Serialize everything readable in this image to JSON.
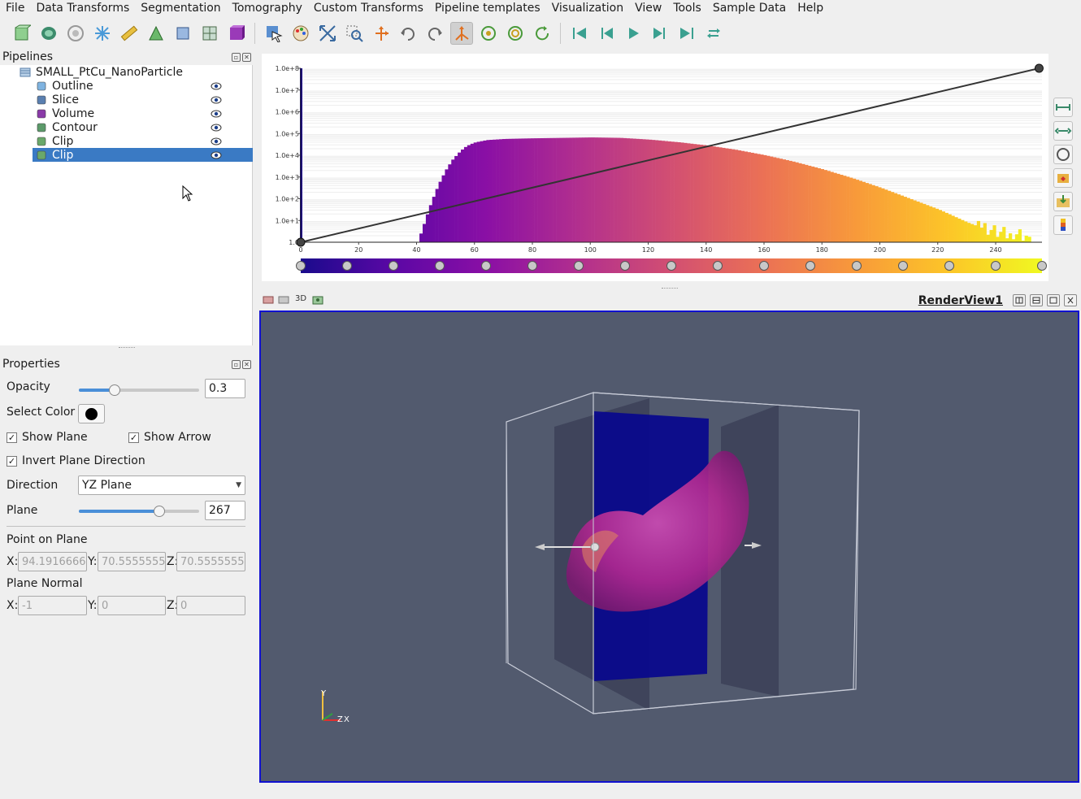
{
  "menu": [
    "File",
    "Data Transforms",
    "Segmentation",
    "Tomography",
    "Custom Transforms",
    "Pipeline templates",
    "Visualization",
    "View",
    "Tools",
    "Sample Data",
    "Help"
  ],
  "pipelines": {
    "title": "Pipelines",
    "root": "SMALL_PtCu_NanoParticle",
    "items": [
      {
        "label": "Outline",
        "icon": "outline-icon",
        "color": "#7fb3e0"
      },
      {
        "label": "Slice",
        "icon": "slice-icon",
        "color": "#5a7fb0"
      },
      {
        "label": "Volume",
        "icon": "volume-icon",
        "color": "#8a3aa8"
      },
      {
        "label": "Contour",
        "icon": "contour-icon",
        "color": "#5c9a6a"
      },
      {
        "label": "Clip",
        "icon": "clip-icon",
        "color": "#6aa86a"
      },
      {
        "label": "Clip",
        "icon": "clip-icon",
        "color": "#6aa86a"
      }
    ]
  },
  "properties": {
    "title": "Properties",
    "opacity_label": "Opacity",
    "opacity_value": "0.3",
    "opacity_fraction": 0.3,
    "select_color_label": "Select Color",
    "show_plane_label": "Show Plane",
    "show_arrow_label": "Show Arrow",
    "invert_label": "Invert Plane Direction",
    "direction_label": "Direction",
    "direction_value": "YZ Plane",
    "plane_label": "Plane",
    "plane_value": "267",
    "plane_fraction": 0.67,
    "point_label": "Point on Plane",
    "point": {
      "x": "94.1916666",
      "y": "70.5555555",
      "z": "70.5555555"
    },
    "normal_label": "Plane Normal",
    "normal": {
      "x": "-1",
      "y": "0",
      "z": "0"
    },
    "x_label": "X:",
    "y_label": "Y:",
    "z_label": "Z:"
  },
  "render_view": {
    "title": "RenderView1",
    "mode": "3D",
    "bg_color": "#525a6e",
    "axes": {
      "y": "Y",
      "z": "Z",
      "x": "X"
    }
  },
  "chart_data": {
    "type": "bar",
    "scale": "log",
    "y_ticks": [
      "1.0",
      "1.0e+1",
      "1.0e+2",
      "1.0e+3",
      "1.0e+4",
      "1.0e+5",
      "1.0e+6",
      "1.0e+7",
      "1.0e+8"
    ],
    "x_ticks": [
      "0",
      "20",
      "40",
      "60",
      "80",
      "100",
      "120",
      "140",
      "160",
      "180",
      "200",
      "220",
      "240"
    ],
    "xlim": [
      0,
      256
    ],
    "ylim_exp": [
      0,
      8
    ],
    "histogram": [
      [
        0,
        8
      ],
      [
        40,
        0
      ],
      [
        42,
        0.8
      ],
      [
        44,
        1.6
      ],
      [
        46,
        2.3
      ],
      [
        48,
        2.9
      ],
      [
        50,
        3.4
      ],
      [
        52,
        3.8
      ],
      [
        54,
        4.1
      ],
      [
        56,
        4.35
      ],
      [
        58,
        4.5
      ],
      [
        60,
        4.6
      ],
      [
        64,
        4.7
      ],
      [
        70,
        4.75
      ],
      [
        80,
        4.78
      ],
      [
        90,
        4.8
      ],
      [
        100,
        4.82
      ],
      [
        110,
        4.8
      ],
      [
        120,
        4.72
      ],
      [
        130,
        4.6
      ],
      [
        140,
        4.45
      ],
      [
        150,
        4.25
      ],
      [
        160,
        4.0
      ],
      [
        170,
        3.7
      ],
      [
        180,
        3.35
      ],
      [
        190,
        2.95
      ],
      [
        200,
        2.5
      ],
      [
        210,
        2.0
      ],
      [
        220,
        1.5
      ],
      [
        225,
        1.2
      ],
      [
        230,
        0.9
      ],
      [
        235,
        0.65
      ],
      [
        240,
        0.5
      ],
      [
        245,
        0.4
      ],
      [
        250,
        0.3
      ]
    ],
    "opacity_line": [
      [
        0,
        0
      ],
      [
        255,
        8
      ]
    ],
    "colormap": [
      "#1a0a8c",
      "#5b07a5",
      "#8a0fa5",
      "#b22f8e",
      "#d24f72",
      "#eb7155",
      "#f89a3a",
      "#fcc628",
      "#f0f921"
    ],
    "colormap_nodes": 17
  }
}
